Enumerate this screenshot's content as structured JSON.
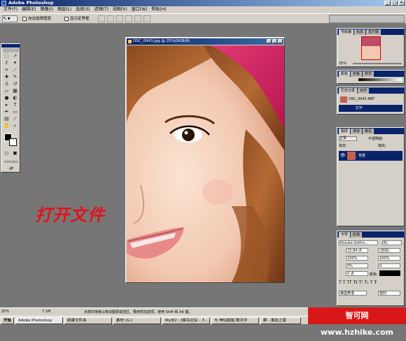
{
  "app": {
    "title": "Adobe Photoshop"
  },
  "menu": [
    "文件(F)",
    "编辑(E)",
    "图像(I)",
    "图层(L)",
    "选择(S)",
    "滤镜(T)",
    "视图(V)",
    "窗口(W)",
    "帮助(H)"
  ],
  "options": {
    "auto_select": "自动选择图层",
    "show_bounds": "显示定界框"
  },
  "document": {
    "title": "DSC_0043.jpg @ 25%(RGB/8)"
  },
  "overlay_text": "打开文件",
  "navigator": {
    "tabs": [
      "导航器",
      "信息",
      "直方图"
    ],
    "zoom": "25%"
  },
  "color": {
    "tabs": [
      "颜色",
      "色板",
      "样式"
    ]
  },
  "history": {
    "tabs": [
      "历史记录",
      "动作"
    ],
    "snapshot": "DSC_0043.NEF",
    "step": "打开"
  },
  "layers": {
    "tabs": [
      "图层",
      "通道",
      "路径"
    ],
    "blend": "正常",
    "opacity_label": "不透明度:",
    "lock": "锁定:",
    "fill": "填充:",
    "layer_name": "背景"
  },
  "character": {
    "tabs": [
      "字符",
      "段落"
    ],
    "font": "Kozuka Gothic...",
    "style": "EL",
    "size": "15.84 点",
    "leading": "(自动)",
    "vscale": "100%",
    "hscale": "100%",
    "tracking": "0%",
    "kerning": "0",
    "color_label": "颜色:",
    "baseline": "0 点",
    "lang": "美国英语",
    "aa": "锐利"
  },
  "status": {
    "zoom": "25%",
    "size": "7.1M",
    "hint": "点按并拖移以移动图层或选区。要用附加选项，使用 Shift 和 Alt 键。"
  },
  "taskbar": {
    "start": "开始",
    "tasks": [
      "Adobe Photoshop",
      "新建文件夹",
      "素材 (G:)",
      "MyIE2 - [蜂鸟论坛 - 人...",
      "与 神仙姐姐 聊天中",
      "群 - 摄友之家"
    ]
  },
  "watermark": "智可网 www.hzhike.com"
}
